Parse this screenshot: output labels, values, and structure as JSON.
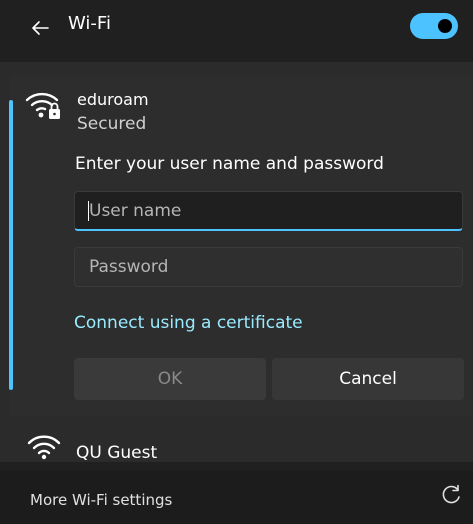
{
  "header": {
    "back_icon": "arrow-left-icon",
    "title": "Wi-Fi",
    "toggle_state": "on",
    "accent_color": "#4cc2ff"
  },
  "networks": [
    {
      "name": "eduroam",
      "status": "Secured",
      "icon": "wifi-lock-icon",
      "expanded": true,
      "auth": {
        "prompt": "Enter your user name and password",
        "username_placeholder": "User name",
        "password_placeholder": "Password",
        "certificate_link": "Connect using a certificate",
        "ok_label": "OK",
        "cancel_label": "Cancel"
      }
    },
    {
      "name": "QU Guest",
      "icon": "wifi-icon",
      "expanded": false
    }
  ],
  "footer": {
    "more_settings": "More Wi-Fi settings",
    "refresh_icon": "refresh-icon"
  }
}
